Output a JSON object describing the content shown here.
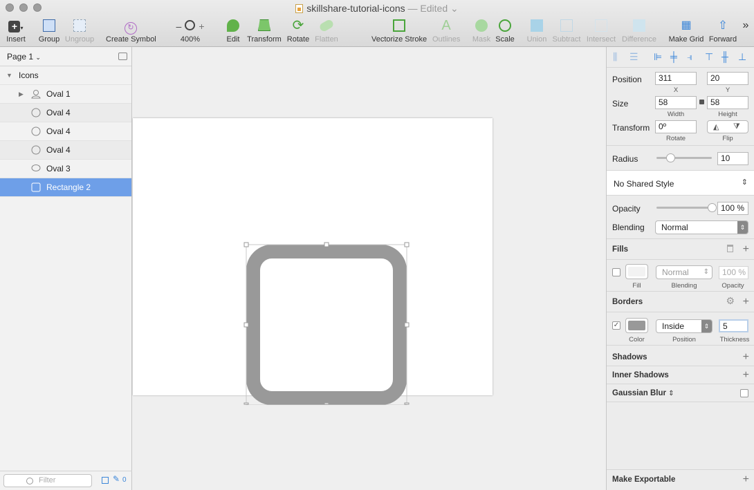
{
  "window": {
    "title": "skillshare-tutorial-icons",
    "status": "— Edited"
  },
  "toolbar": {
    "insert": "Insert",
    "group": "Group",
    "ungroup": "Ungroup",
    "create_symbol": "Create Symbol",
    "zoom": "400%",
    "zoom_minus": "–",
    "zoom_plus": "+",
    "edit": "Edit",
    "transform": "Transform",
    "rotate": "Rotate",
    "flatten": "Flatten",
    "vectorize_stroke": "Vectorize Stroke",
    "outlines": "Outlines",
    "mask": "Mask",
    "scale": "Scale",
    "union": "Union",
    "subtract": "Subtract",
    "intersect": "Intersect",
    "difference": "Difference",
    "make_grid": "Make Grid",
    "forward": "Forward",
    "overflow": "»"
  },
  "layers": {
    "page": "Page 1",
    "group_name": "Icons",
    "items": [
      {
        "name": "Oval 1",
        "icon": "person-icon"
      },
      {
        "name": "Oval 4",
        "icon": "oval-icon"
      },
      {
        "name": "Oval 4",
        "icon": "oval-icon"
      },
      {
        "name": "Oval 4",
        "icon": "oval-icon"
      },
      {
        "name": "Oval 3",
        "icon": "speech-bubble-icon"
      },
      {
        "name": "Rectangle 2",
        "icon": "rectangle-icon"
      }
    ],
    "filter_placeholder": "Filter",
    "filter_count": "0"
  },
  "inspector": {
    "position_label": "Position",
    "x": "311",
    "y": "20",
    "x_label": "X",
    "y_label": "Y",
    "size_label": "Size",
    "width": "58",
    "height": "58",
    "width_label": "Width",
    "height_label": "Height",
    "transform_label": "Transform",
    "rotate": "0º",
    "rotate_label": "Rotate",
    "flip_label": "Flip",
    "radius_label": "Radius",
    "radius": "10",
    "radius_slider": 0.25,
    "shared_style": "No Shared Style",
    "opacity_label": "Opacity",
    "opacity": "100 %",
    "opacity_slider": 1.0,
    "blending_label": "Blending",
    "blending": "Normal",
    "fills": {
      "title": "Fills",
      "enabled": false,
      "blending": "Normal",
      "opacity": "100 %",
      "sub_fill": "Fill",
      "sub_blending": "Blending",
      "sub_opacity": "Opacity",
      "color": "#f2f2f2"
    },
    "borders": {
      "title": "Borders",
      "enabled": true,
      "position": "Inside",
      "thickness": "5",
      "sub_color": "Color",
      "sub_position": "Position",
      "sub_thickness": "Thickness",
      "color": "#999999"
    },
    "shadows": "Shadows",
    "inner_shadows": "Inner Shadows",
    "gaussian_blur": "Gaussian Blur",
    "make_exportable": "Make Exportable"
  },
  "colors": {
    "selection": "#6e9fe8",
    "accent": "#3b86d9",
    "border": "#999999"
  }
}
